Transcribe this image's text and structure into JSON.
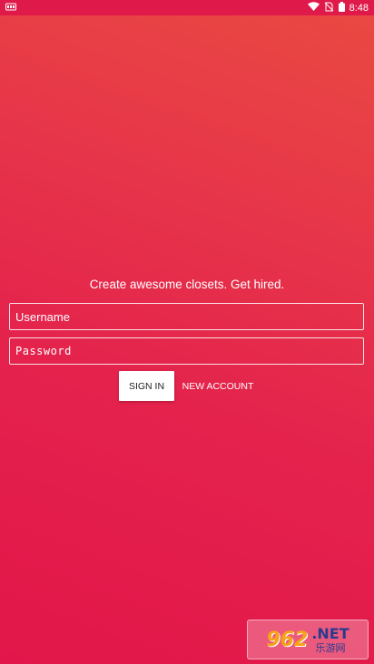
{
  "status_bar": {
    "time": "8:48",
    "icons": [
      "notification-icon",
      "wifi-icon",
      "no-sim-icon",
      "battery-icon"
    ]
  },
  "tagline": "Create awesome closets. Get hired.",
  "form": {
    "username_placeholder": "Username",
    "password_placeholder": "Password",
    "sign_in_label": "SIGN IN",
    "new_account_label": "NEW ACCOUNT"
  },
  "watermark": {
    "number": "962",
    "suffix": ".NET",
    "subtitle": "乐游网"
  },
  "colors": {
    "background_top": "#ea4a42",
    "background_bottom": "#e2164a",
    "status_bar": "#e0194b"
  }
}
